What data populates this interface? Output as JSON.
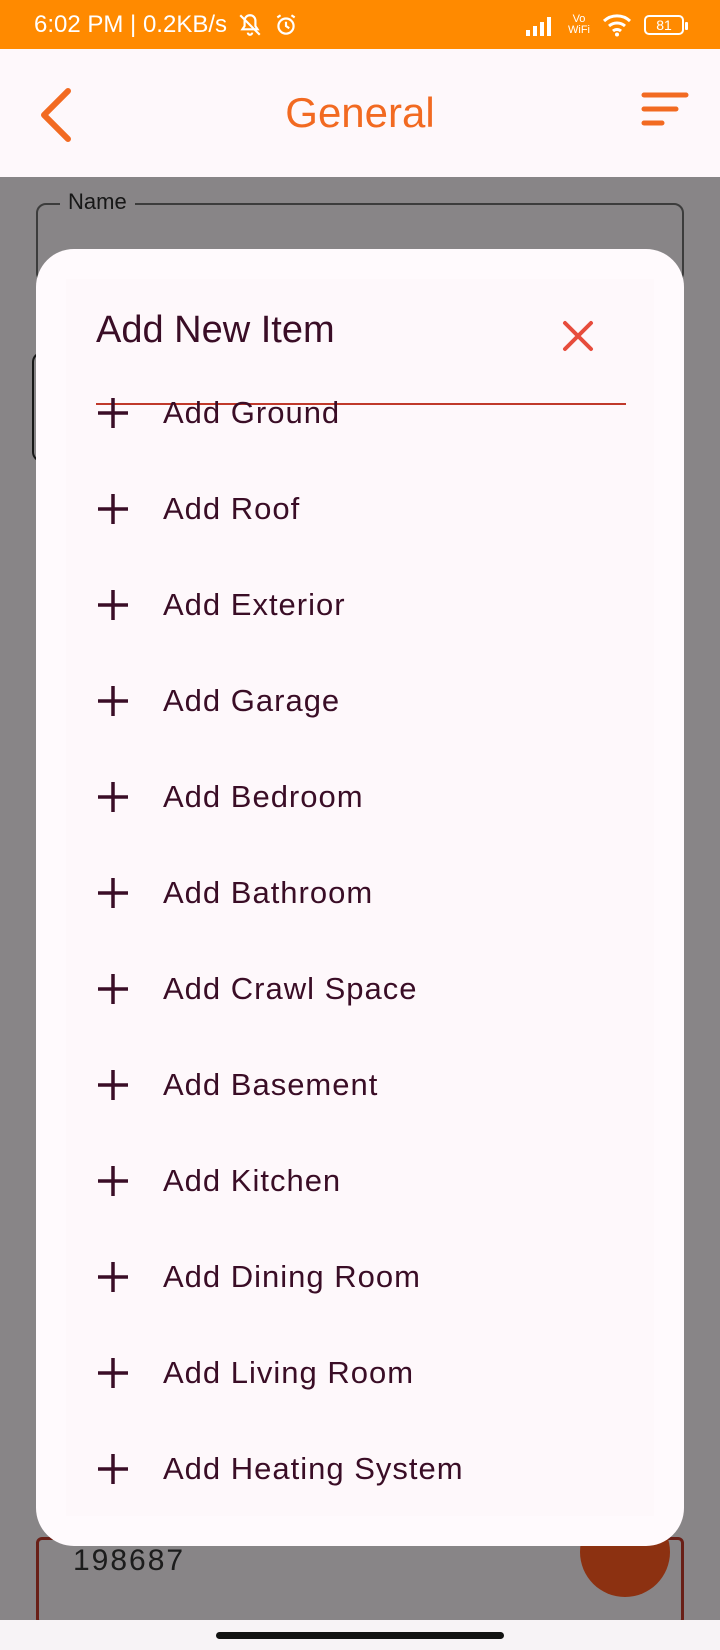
{
  "status_bar": {
    "time_speed": "6:02 PM | 0.2KB/s",
    "vowifi_top": "Vo",
    "vowifi_bottom": "WiFi",
    "battery": "81"
  },
  "app_bar": {
    "title": "General",
    "back_icon": "chevron-left-icon",
    "menu_icon": "sort-lines-icon",
    "accent_color": "#f26a21"
  },
  "form": {
    "name_label": "Name",
    "bottom_value": "198687"
  },
  "dialog": {
    "title": "Add New Item",
    "close_icon": "close-icon",
    "close_color": "#e74c3c",
    "divider_color": "#c0392b",
    "items": [
      {
        "label": "Add Ground"
      },
      {
        "label": "Add Roof"
      },
      {
        "label": "Add Exterior"
      },
      {
        "label": "Add Garage"
      },
      {
        "label": "Add Bedroom"
      },
      {
        "label": "Add Bathroom"
      },
      {
        "label": "Add Crawl Space"
      },
      {
        "label": "Add Basement"
      },
      {
        "label": "Add Kitchen"
      },
      {
        "label": "Add Dining Room"
      },
      {
        "label": "Add Living Room"
      },
      {
        "label": "Add Heating System"
      }
    ]
  },
  "colors": {
    "status_bar": "#ff8a00",
    "text_dark": "#3a0d26"
  }
}
